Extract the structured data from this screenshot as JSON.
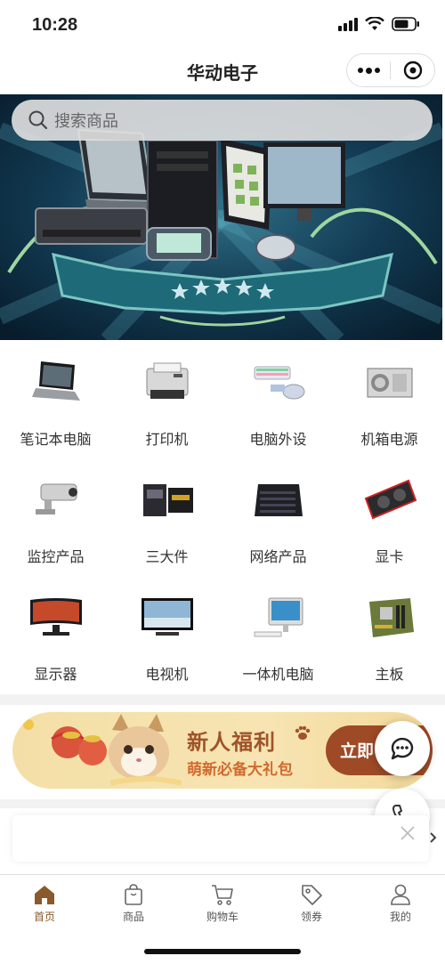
{
  "status": {
    "time": "10:28"
  },
  "nav": {
    "title": "华动电子"
  },
  "search": {
    "placeholder": "搜索商品"
  },
  "categories": [
    {
      "label": "笔记本电脑",
      "icon": "laptop-icon"
    },
    {
      "label": "打印机",
      "icon": "printer-icon"
    },
    {
      "label": "电脑外设",
      "icon": "keyboard-mouse-icon"
    },
    {
      "label": "机箱电源",
      "icon": "power-supply-icon"
    },
    {
      "label": "监控产品",
      "icon": "security-camera-icon"
    },
    {
      "label": "三大件",
      "icon": "motherboard-box-icon"
    },
    {
      "label": "网络产品",
      "icon": "network-switch-icon"
    },
    {
      "label": "显卡",
      "icon": "graphics-card-icon"
    },
    {
      "label": "显示器",
      "icon": "monitor-icon"
    },
    {
      "label": "电视机",
      "icon": "tv-icon"
    },
    {
      "label": "一体机电脑",
      "icon": "all-in-one-pc-icon"
    },
    {
      "label": "主板",
      "icon": "mainboard-icon"
    }
  ],
  "promo": {
    "title": "新人福利",
    "subtitle": "萌新必备大礼包",
    "button": "立即"
  },
  "tabs": [
    {
      "label": "首页",
      "icon": "home-icon",
      "active": true
    },
    {
      "label": "商品",
      "icon": "shopping-bag-icon"
    },
    {
      "label": "购物车",
      "icon": "cart-icon"
    },
    {
      "label": "领券",
      "icon": "coupon-tag-icon"
    },
    {
      "label": "我的",
      "icon": "profile-icon"
    }
  ],
  "colors": {
    "accent": "#8a5a2c",
    "promo_button": "#9e4a26",
    "promo_title": "#a0532b",
    "promo_sub": "#d26a2e"
  }
}
